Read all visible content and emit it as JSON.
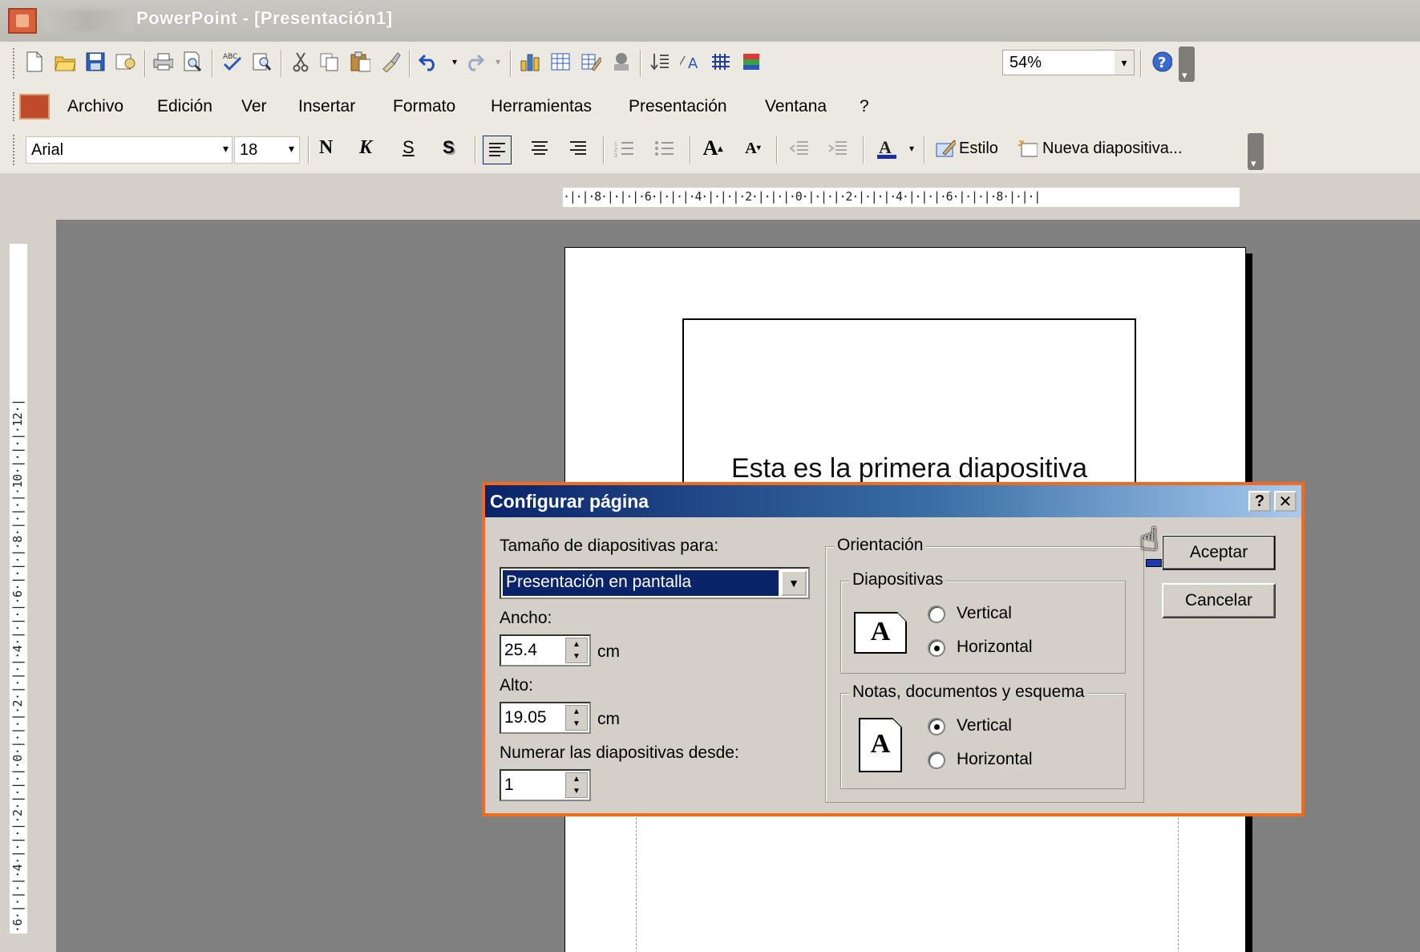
{
  "window": {
    "title": "PowerPoint - [Presentación1]"
  },
  "standard_toolbar": {
    "zoom": "54%",
    "icons": [
      "new-icon",
      "open-icon",
      "save-icon",
      "permission-icon",
      "print-icon",
      "print-preview-icon",
      "spelling-icon",
      "research-icon",
      "cut-icon",
      "copy-icon",
      "paste-icon",
      "format-painter-icon",
      "undo-icon",
      "redo-icon",
      "insert-chart-icon",
      "insert-table-icon",
      "tables-borders-icon",
      "insert-picture-icon",
      "expand-all-icon",
      "show-formatting-icon",
      "grid-icon",
      "color-grayscale-icon",
      "help-icon"
    ]
  },
  "menubar": {
    "items": [
      "Archivo",
      "Edición",
      "Ver",
      "Insertar",
      "Formato",
      "Herramientas",
      "Presentación",
      "Ventana",
      "?"
    ]
  },
  "format_toolbar": {
    "font": "Arial",
    "size": "18",
    "bold": "N",
    "italic": "K",
    "underline": "S",
    "shadow": "S",
    "style_label": "Estilo",
    "new_slide_label": "Nueva diapositiva..."
  },
  "rulers": {
    "horizontal": "·|·|·8·|·|·|·6·|·|·|·4·|·|·|·2·|·|·|·0·|·|·|·2·|·|·|·4·|·|·|·6·|·|·|·8·|·|·|",
    "vertical": "·6·|·|·|·4·|·|·|·2·|·|·|·0·|·|·|·2·|·|·|·4·|·|·|·6·|·|·|·8·|·|·|·10·|·|·|·12·|"
  },
  "slide": {
    "text": "Esta es la primera diapositiva"
  },
  "dialog": {
    "title": "Configurar página",
    "help_label": "?",
    "close_label": "✕",
    "size_for_label": "Tamaño de diapositivas para:",
    "size_for_value": "Presentación en pantalla",
    "width_label": "Ancho:",
    "width_value": "25.4",
    "width_unit": "cm",
    "height_label": "Alto:",
    "height_value": "19.05",
    "height_unit": "cm",
    "number_from_label": "Numerar las diapositivas desde:",
    "number_from_value": "1",
    "orientation_label": "Orientación",
    "slides_group_label": "Diapositivas",
    "slides_vertical": "Vertical",
    "slides_horizontal": "Horizontal",
    "notes_group_label": "Notas, documentos y esquema",
    "notes_vertical": "Vertical",
    "notes_horizontal": "Horizontal",
    "paper_letter": "A",
    "ok_label": "Aceptar",
    "cancel_label": "Cancelar"
  },
  "colors": {
    "dialog_border": "#f26a1d",
    "title_gradient_start": "#0a246a",
    "title_gradient_end": "#a6caf0",
    "workspace": "#808080"
  }
}
